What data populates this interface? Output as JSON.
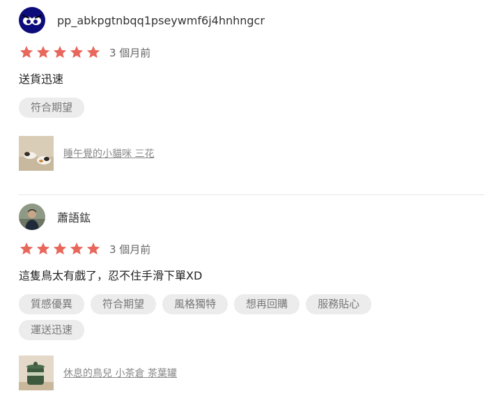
{
  "reviews": [
    {
      "username": "pp_abkpgtnbqq1pseywmf6j4hnhngcr",
      "rating": 5,
      "time": "3 個月前",
      "content": "送貨迅速",
      "tags": [
        "符合期望"
      ],
      "product": "睡午覺的小貓咪 三花"
    },
    {
      "username": "蕭語鈜",
      "rating": 5,
      "time": "3 個月前",
      "content": "這隻鳥太有戲了，忍不住手滑下單XD",
      "tags": [
        "質感優異",
        "符合期望",
        "風格獨特",
        "想再回購",
        "服務貼心",
        "運送迅速"
      ],
      "product": "休息的鳥兒 小茶倉 茶葉罐"
    }
  ],
  "colors": {
    "star": "#e8675c",
    "tag_bg": "#ececec",
    "divider": "#e6e6e6"
  }
}
